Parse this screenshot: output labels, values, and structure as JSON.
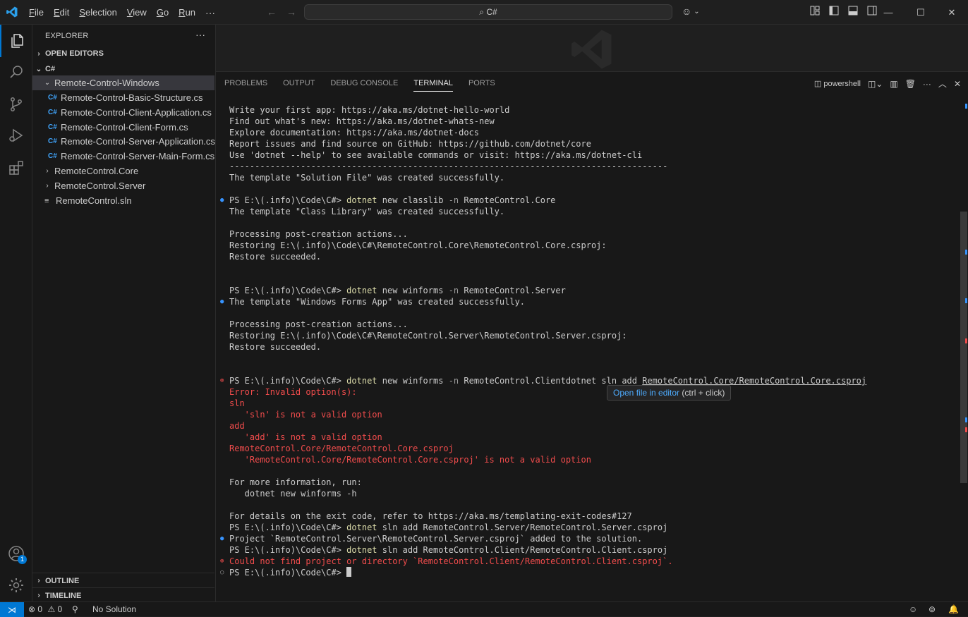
{
  "titlebar": {
    "menu": [
      "File",
      "Edit",
      "Selection",
      "View",
      "Go",
      "Run"
    ],
    "more": "···",
    "search_text": "C#"
  },
  "activity": {
    "accounts_badge": "1"
  },
  "sidebar": {
    "title": "EXPLORER",
    "more": "···",
    "open_editors": "OPEN EDITORS",
    "folder": "C#",
    "tree": [
      {
        "label": "Remote-Control-Windows",
        "type": "folder-open"
      },
      {
        "label": "Remote-Control-Basic-Structure.cs",
        "type": "cs"
      },
      {
        "label": "Remote-Control-Client-Application.cs",
        "type": "cs"
      },
      {
        "label": "Remote-Control-Client-Form.cs",
        "type": "cs"
      },
      {
        "label": "Remote-Control-Server-Application.cs",
        "type": "cs"
      },
      {
        "label": "Remote-Control-Server-Main-Form.cs",
        "type": "cs"
      },
      {
        "label": "RemoteControl.Core",
        "type": "folder"
      },
      {
        "label": "RemoteControl.Server",
        "type": "folder"
      },
      {
        "label": "RemoteControl.sln",
        "type": "sln"
      }
    ],
    "outline": "OUTLINE",
    "timeline": "TIMELINE"
  },
  "panel": {
    "tabs": [
      "PROBLEMS",
      "OUTPUT",
      "DEBUG CONSOLE",
      "TERMINAL",
      "PORTS"
    ],
    "active_tab": "TERMINAL",
    "shell": "powershell",
    "tooltip_link": "Open file in editor",
    "tooltip_hint": "(ctrl + click)"
  },
  "terminal": {
    "l0": "Write your first app: https://aka.ms/dotnet-hello-world",
    "l1": "Find out what's new: https://aka.ms/dotnet-whats-new",
    "l2": "Explore documentation: https://aka.ms/dotnet-docs",
    "l3": "Report issues and find source on GitHub: https://github.com/dotnet/core",
    "l4": "Use 'dotnet --help' to see available commands or visit: https://aka.ms/dotnet-cli",
    "l5": "--------------------------------------------------------------------------------------",
    "l6": "The template \"Solution File\" was created successfully.",
    "prompt": "PS E:\\(.info)\\Code\\C#> ",
    "c1_cmd": "dotnet",
    "c1_rest1": " new classlib ",
    "c1_flag": "-n",
    "c1_rest2": " RemoteControl.Core",
    "l8": "The template \"Class Library\" was created successfully.",
    "l10": "Processing post-creation actions...",
    "l11": "Restoring E:\\(.info)\\Code\\C#\\RemoteControl.Core\\RemoteControl.Core.csproj:",
    "l12": "Restore succeeded.",
    "c2_cmd": "dotnet",
    "c2_rest1": " new winforms ",
    "c2_flag": "-n",
    "c2_rest2": " RemoteControl.Server",
    "l16": "The template \"Windows Forms App\" was created successfully.",
    "l18": "Processing post-creation actions...",
    "l19": "Restoring E:\\(.info)\\Code\\C#\\RemoteControl.Server\\RemoteControl.Server.csproj:",
    "l20": "Restore succeeded.",
    "c3_cmd": "dotnet",
    "c3_rest1": " new winforms ",
    "c3_flag": "-n",
    "c3_rest2": " RemoteControl.Clientdotnet sln add ",
    "c3_link": "RemoteControl.Core/RemoteControl.Core.csproj",
    "e1": "Error: Invalid option(s):",
    "e2": "sln",
    "e3": "   'sln' is not a valid option",
    "e4": "add",
    "e5": "   'add' is not a valid option",
    "e6": "RemoteControl.Core/RemoteControl.Core.csproj",
    "e7": "   'RemoteControl.Core/RemoteControl.Core.csproj' is not a valid option",
    "l34": "For more information, run:",
    "l35": "   dotnet new winforms -h",
    "l37": "For details on the exit code, refer to https://aka.ms/templating-exit-codes#127",
    "c4_cmd": "dotnet",
    "c4_rest": " sln add RemoteControl.Server/RemoteControl.Server.csproj",
    "l39": "Project `RemoteControl.Server\\RemoteControl.Server.csproj` added to the solution.",
    "c5_cmd": "dotnet",
    "c5_rest": " sln add RemoteControl.Client/RemoteControl.Client.csproj",
    "l41": "Could not find project or directory `RemoteControl.Client/RemoteControl.Client.csproj`."
  },
  "statusbar": {
    "errors": "0",
    "warnings": "0",
    "solution": "No Solution"
  },
  "colors": {
    "accent": "#0078d4",
    "error": "#f14c4c",
    "command": "#dcdcaa"
  }
}
